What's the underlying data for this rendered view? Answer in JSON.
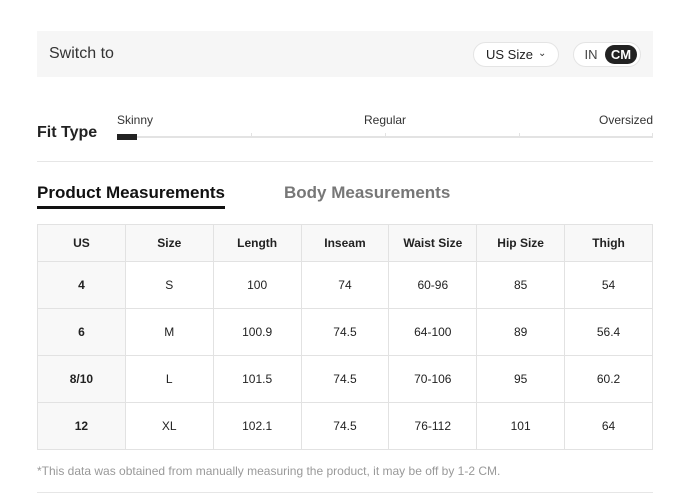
{
  "switch_bar": {
    "label": "Switch to",
    "size_select": "US Size",
    "unit_options": [
      "IN",
      "CM"
    ],
    "unit_selected": "CM"
  },
  "fit_type": {
    "title": "Fit Type",
    "labels": [
      "Skinny",
      "Regular",
      "Oversized"
    ],
    "selected": "Skinny"
  },
  "tabs": [
    {
      "label": "Product Measurements",
      "active": true
    },
    {
      "label": "Body Measurements",
      "active": false
    }
  ],
  "table": {
    "headers": [
      "US",
      "Size",
      "Length",
      "Inseam",
      "Waist Size",
      "Hip Size",
      "Thigh"
    ],
    "rows": [
      [
        "4",
        "S",
        "100",
        "74",
        "60-96",
        "85",
        "54"
      ],
      [
        "6",
        "M",
        "100.9",
        "74.5",
        "64-100",
        "89",
        "56.4"
      ],
      [
        "8/10",
        "L",
        "101.5",
        "74.5",
        "70-106",
        "95",
        "60.2"
      ],
      [
        "12",
        "XL",
        "102.1",
        "74.5",
        "76-112",
        "101",
        "64"
      ]
    ]
  },
  "note": "*This data was obtained from manually measuring the product, it may be off by 1-2 CM."
}
